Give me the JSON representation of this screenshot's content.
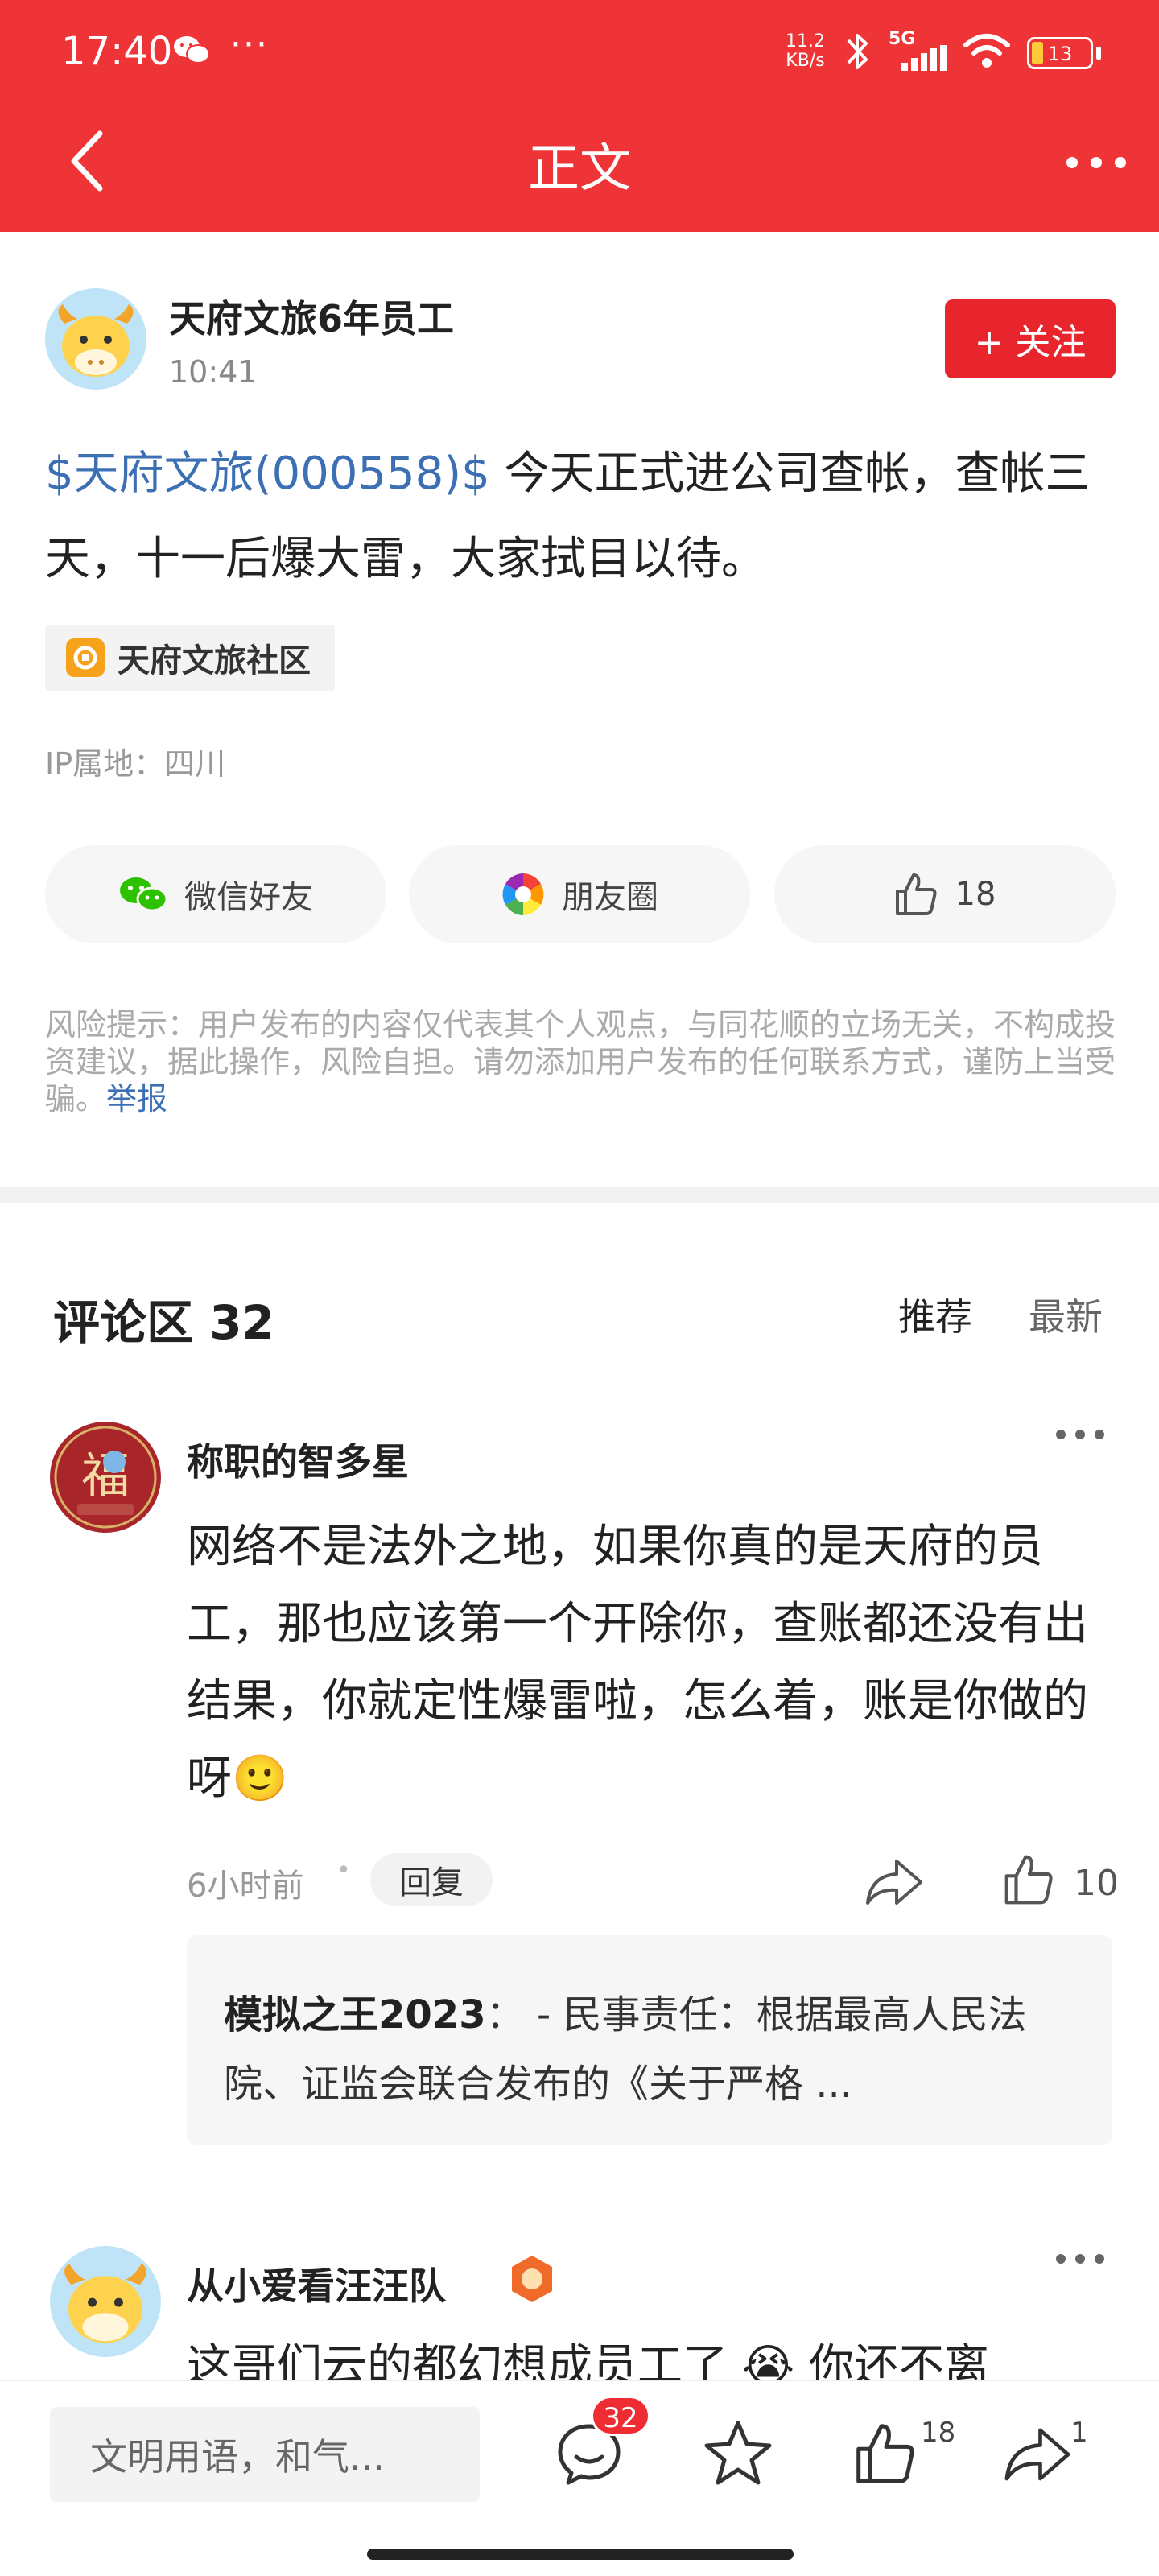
{
  "status_bar": {
    "time": "17:40",
    "more": "···",
    "net_speed_value": "11.2",
    "net_speed_unit": "KB/s",
    "network": "5G",
    "battery": "13",
    "icons": [
      "wechat-icon",
      "bluetooth-icon",
      "signal-icon",
      "wifi-icon",
      "battery-icon"
    ]
  },
  "header": {
    "title": "正文",
    "back_icon": "back-arrow-icon",
    "more_icon": "more-dots-icon",
    "color": "#ee3437"
  },
  "post": {
    "author": "天府文旅6年员工",
    "time": "10:41",
    "follow_label": "+ 关注",
    "stock_tag": "$天府文旅(000558)$",
    "text": " 今天正式进公司查帐，查帐三天，十一后爆大雷，大家拭目以待。",
    "community": "天府文旅社区",
    "ip": "IP属地：四川",
    "share": {
      "wechat_label": "微信好友",
      "moments_label": "朋友圈",
      "like_count": "18"
    },
    "risk_text": "风险提示：用户发布的内容仅代表其个人观点，与同花顺的立场无关，不构成投资建议，据此操作，风险自担。请勿添加用户发布的任何联系方式，谨防上当受骗。",
    "report_label": "举报"
  },
  "comments": {
    "title": "评论区 32",
    "tabs": [
      "推荐",
      "最新"
    ],
    "items": [
      {
        "name": "称职的智多星",
        "text": "网络不是法外之地，如果你真的是天府的员工，那也应该第一个开除你，查账都还没有出结果，你就定性爆雷啦，怎么着，账是你做的呀",
        "emoji": "🙂",
        "time": "6小时前",
        "dot": "•",
        "reply_label": "回复",
        "likes": "10",
        "reply": {
          "name": "模拟之王2023",
          "sep": "：",
          "text": " - 民事责任：根据最高人民法院、证监会联合发布的《关于严格 ..."
        }
      },
      {
        "name": "从小爱看汪汪队",
        "text": "这哥们云的都幻想成员工了 😭 你还不离"
      }
    ]
  },
  "bottom_bar": {
    "input_placeholder": "文明用语，和气...",
    "comment_count": "32",
    "like_count": "18",
    "share_count": "1"
  }
}
